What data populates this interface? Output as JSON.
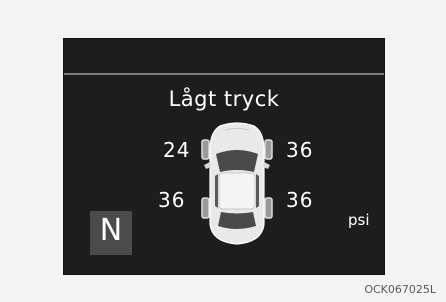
{
  "display": {
    "warning_title": "Lågt tryck",
    "gear": "N",
    "unit": "psi"
  },
  "tires": {
    "front_left": "24",
    "front_right": "36",
    "rear_left": "36",
    "rear_right": "36"
  },
  "icons": {
    "car": "car-top-view-icon"
  },
  "figure_code": "OCK067025L",
  "colors": {
    "screen_bg": "#1d1d1d",
    "text": "#ffffff",
    "gear_box": "#4b4b4b",
    "page_bg": "#f3f3f3"
  }
}
